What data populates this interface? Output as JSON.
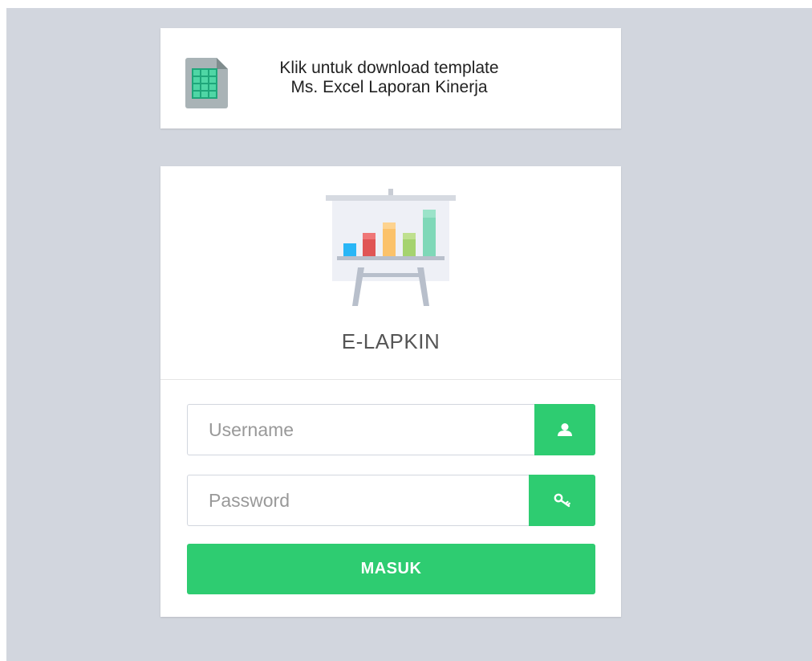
{
  "download": {
    "line1": "Klik untuk download template",
    "line2": "Ms. Excel Laporan Kinerja",
    "icon": "spreadsheet-icon"
  },
  "login": {
    "app_title": "E-LAPKIN",
    "illustration": "presentation-board-chart",
    "username": {
      "value": "",
      "placeholder": "Username",
      "icon": "user-icon"
    },
    "password": {
      "value": "",
      "placeholder": "Password",
      "icon": "key-icon"
    },
    "submit_label": "MASUK"
  },
  "colors": {
    "background": "#d2d6de",
    "accent": "#2ecc71",
    "card": "#ffffff"
  }
}
